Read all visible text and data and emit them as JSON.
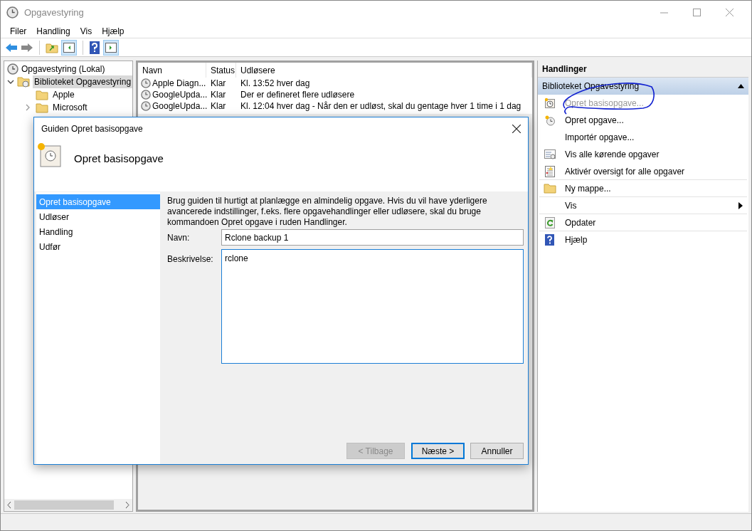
{
  "window": {
    "title": "Opgavestyring"
  },
  "menu": [
    "Filer",
    "Handling",
    "Vis",
    "Hjælp"
  ],
  "tree": {
    "root": "Opgavestyring (Lokal)",
    "items": [
      {
        "label": "Biblioteket Opgavestyring",
        "expanded": true,
        "selected": true,
        "children": [
          {
            "label": "Apple"
          },
          {
            "label": "Microsoft",
            "expanded": false
          }
        ]
      }
    ]
  },
  "table": {
    "columns": [
      "Navn",
      "Status",
      "Udløsere"
    ],
    "rows": [
      {
        "name": "Apple Diagn...",
        "status": "Klar",
        "trigger": "Kl. 13:52  hver dag"
      },
      {
        "name": "GoogleUpda...",
        "status": "Klar",
        "trigger": "Der er defineret flere udløsere"
      },
      {
        "name": "GoogleUpda...",
        "status": "Klar",
        "trigger": "Kl. 12:04  hver dag - Når den er udløst, skal du gentage hver 1 time i 1 dag"
      }
    ]
  },
  "actions": {
    "title": "Handlinger",
    "section": "Biblioteket Opgavestyring",
    "items": [
      {
        "label": "Opret basisopgave...",
        "kind": "wizard",
        "disabled": true,
        "submenu": false,
        "separator_after": false
      },
      {
        "label": "Opret opgave...",
        "kind": "task",
        "disabled": false,
        "submenu": false,
        "separator_after": false
      },
      {
        "label": "Importér opgave...",
        "kind": "plain",
        "disabled": false,
        "submenu": false,
        "separator_after": false
      },
      {
        "label": "Vis alle kørende opgaver",
        "kind": "list",
        "disabled": false,
        "submenu": false,
        "separator_after": false
      },
      {
        "label": "Aktivér oversigt for alle opgaver",
        "kind": "summary",
        "disabled": false,
        "submenu": false,
        "separator_after": true
      },
      {
        "label": "Ny mappe...",
        "kind": "folder",
        "disabled": false,
        "submenu": false,
        "separator_after": true
      },
      {
        "label": "Vis",
        "kind": "plain",
        "disabled": false,
        "submenu": true,
        "separator_after": true
      },
      {
        "label": "Opdater",
        "kind": "refresh",
        "disabled": false,
        "submenu": false,
        "separator_after": true
      },
      {
        "label": "Hjælp",
        "kind": "help",
        "disabled": false,
        "submenu": false,
        "separator_after": false
      }
    ]
  },
  "dialog": {
    "title": "Guiden Opret basisopgave",
    "heading": "Opret basisopgave",
    "steps": [
      {
        "label": "Opret basisopgave",
        "selected": true
      },
      {
        "label": "Udløser",
        "selected": false
      },
      {
        "label": "Handling",
        "selected": false
      },
      {
        "label": "Udfør",
        "selected": false
      }
    ],
    "intro": "Brug guiden til hurtigt at planlægge en almindelig opgave. Hvis du vil have yderligere avancerede indstillinger, f.eks. flere opgavehandlinger eller udløsere, skal du bruge kommandoen Opret opgave i ruden Handlinger.",
    "name": {
      "label": "Navn:",
      "value": "Rclone backup 1"
    },
    "description": {
      "label": "Beskrivelse:",
      "value": "rclone"
    },
    "buttons": [
      {
        "label": "< Tilbage",
        "disabled": true,
        "default": false
      },
      {
        "label": "Næste >",
        "disabled": false,
        "default": true
      },
      {
        "label": "Annuller",
        "disabled": false,
        "default": false
      }
    ]
  }
}
